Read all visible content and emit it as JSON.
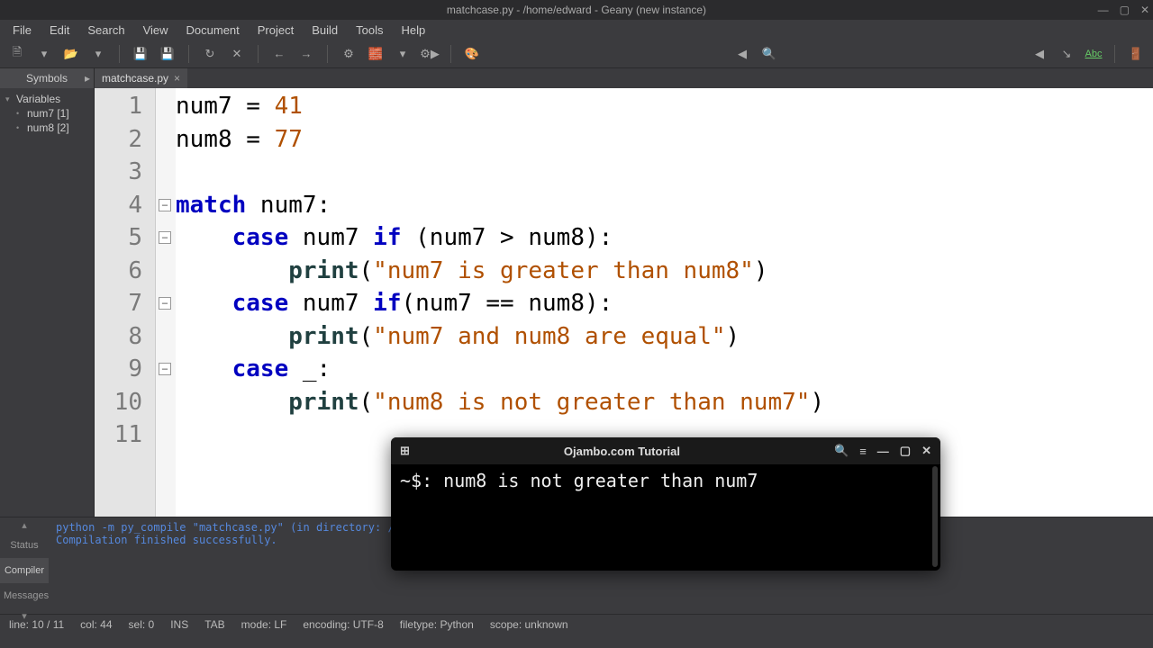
{
  "window": {
    "title": "matchcase.py - /home/edward - Geany (new instance)"
  },
  "menus": [
    "File",
    "Edit",
    "Search",
    "View",
    "Document",
    "Project",
    "Build",
    "Tools",
    "Help"
  ],
  "sidebar": {
    "tab": "Symbols",
    "root": "Variables",
    "items": [
      "num7 [1]",
      "num8 [2]"
    ]
  },
  "tab": {
    "label": "matchcase.py"
  },
  "code_lines": [
    {
      "n": "1",
      "indent": "",
      "tokens": [
        [
          "plain",
          "num7 = "
        ],
        [
          "num",
          "41"
        ]
      ]
    },
    {
      "n": "2",
      "indent": "",
      "tokens": [
        [
          "plain",
          "num8 = "
        ],
        [
          "num",
          "77"
        ]
      ]
    },
    {
      "n": "3",
      "indent": "",
      "tokens": []
    },
    {
      "n": "4",
      "indent": "",
      "fold": true,
      "tokens": [
        [
          "kw",
          "match"
        ],
        [
          "plain",
          " num7:"
        ]
      ]
    },
    {
      "n": "5",
      "indent": "    ",
      "fold": true,
      "tokens": [
        [
          "kw",
          "case"
        ],
        [
          "plain",
          " num7 "
        ],
        [
          "kw",
          "if"
        ],
        [
          "plain",
          " (num7 > num8):"
        ]
      ]
    },
    {
      "n": "6",
      "indent": "        ",
      "tokens": [
        [
          "fn",
          "print"
        ],
        [
          "plain",
          "("
        ],
        [
          "str",
          "\"num7 is greater than num8\""
        ],
        [
          "plain",
          ")"
        ]
      ]
    },
    {
      "n": "7",
      "indent": "    ",
      "fold": true,
      "tokens": [
        [
          "kw",
          "case"
        ],
        [
          "plain",
          " num7 "
        ],
        [
          "kw",
          "if"
        ],
        [
          "plain",
          "(num7 == num8):"
        ]
      ]
    },
    {
      "n": "8",
      "indent": "        ",
      "tokens": [
        [
          "fn",
          "print"
        ],
        [
          "plain",
          "("
        ],
        [
          "str",
          "\"num7 and num8 are equal\""
        ],
        [
          "plain",
          ")"
        ]
      ]
    },
    {
      "n": "9",
      "indent": "    ",
      "fold": true,
      "tokens": [
        [
          "kw",
          "case"
        ],
        [
          "plain",
          " _:"
        ]
      ]
    },
    {
      "n": "10",
      "indent": "        ",
      "tokens": [
        [
          "fn",
          "print"
        ],
        [
          "plain",
          "("
        ],
        [
          "str",
          "\"num8 is not greater than num7\""
        ],
        [
          "plain",
          ")"
        ]
      ]
    },
    {
      "n": "11",
      "indent": "",
      "tokens": []
    }
  ],
  "bottom": {
    "tabs": [
      "Status",
      "Compiler",
      "Messages"
    ],
    "active": 1,
    "lines": [
      "python -m py_compile \"matchcase.py\" (in directory: /home/edward)",
      "Compilation finished successfully."
    ]
  },
  "status": {
    "line": "line: 10 / 11",
    "col": "col: 44",
    "sel": "sel: 0",
    "ins": "INS",
    "tab": "TAB",
    "mode": "mode: LF",
    "enc": "encoding: UTF-8",
    "ftype": "filetype: Python",
    "scope": "scope: unknown"
  },
  "terminal": {
    "title": "Ojambo.com Tutorial",
    "prompt": "~$:",
    "output": "num8 is not greater than num7"
  }
}
